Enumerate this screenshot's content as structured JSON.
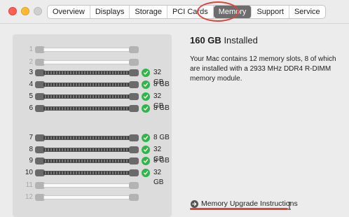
{
  "window": {
    "controls": [
      "close",
      "minimize",
      "zoom"
    ]
  },
  "tabs": [
    {
      "label": "Overview",
      "active": false
    },
    {
      "label": "Displays",
      "active": false
    },
    {
      "label": "Storage",
      "active": false
    },
    {
      "label": "PCI Cards",
      "active": false
    },
    {
      "label": "Memory",
      "active": true
    },
    {
      "label": "Support",
      "active": false
    },
    {
      "label": "Service",
      "active": false
    }
  ],
  "memory": {
    "installed_value": "160 GB",
    "installed_label": "Installed",
    "description": "Your Mac contains 12 memory slots, 8 of which are installed with a 2933 MHz DDR4 R-DIMM memory module.",
    "upgrade_link": "Memory Upgrade Instructions"
  },
  "slots": [
    {
      "num": "1",
      "filled": false,
      "size": ""
    },
    {
      "num": "2",
      "filled": false,
      "size": ""
    },
    {
      "num": "3",
      "filled": true,
      "size": "32 GB"
    },
    {
      "num": "4",
      "filled": true,
      "size": "8 GB"
    },
    {
      "num": "5",
      "filled": true,
      "size": "32 GB"
    },
    {
      "num": "6",
      "filled": true,
      "size": "8 GB"
    },
    {
      "num": "7",
      "filled": true,
      "size": "8 GB"
    },
    {
      "num": "8",
      "filled": true,
      "size": "32 GB"
    },
    {
      "num": "9",
      "filled": true,
      "size": "8 GB"
    },
    {
      "num": "10",
      "filled": true,
      "size": "32 GB"
    },
    {
      "num": "11",
      "filled": false,
      "size": ""
    },
    {
      "num": "12",
      "filled": false,
      "size": ""
    }
  ],
  "colors": {
    "check": "#2fb54a",
    "annotation": "#d9463e",
    "active_tab": "#6d6d6d"
  }
}
